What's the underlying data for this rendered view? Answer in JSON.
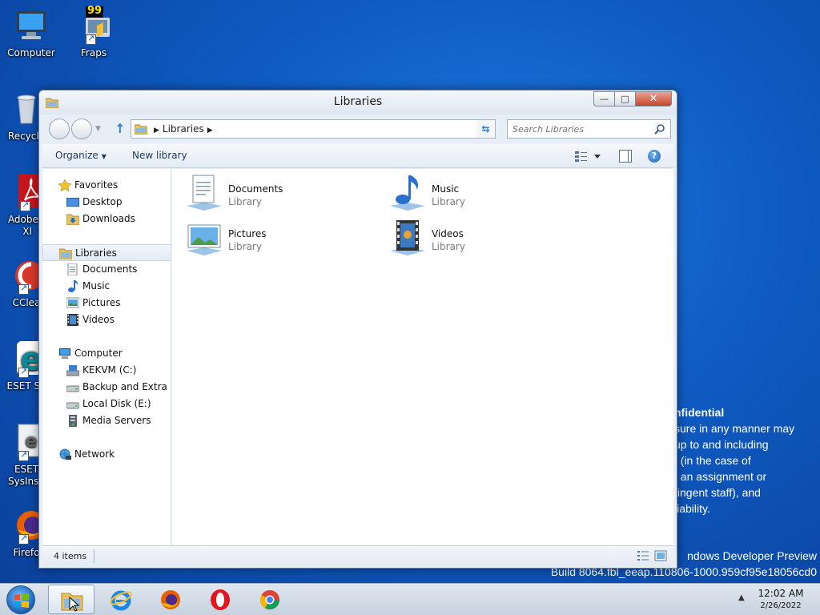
{
  "desktop": {
    "icons": [
      {
        "label": "Computer"
      },
      {
        "label": "Fraps",
        "badge": "99"
      },
      {
        "label": "Recycle"
      },
      {
        "label": "Adobe R",
        "label2": "XI"
      },
      {
        "label": "CClea"
      },
      {
        "label": "ESET Se"
      },
      {
        "label": "ESET",
        "label2": "SysInsp"
      },
      {
        "label": "Firefo"
      }
    ],
    "watermark": {
      "title": "nfidential",
      "lines": [
        "sure in any manner may",
        "up to and including",
        "t (in the case of",
        "f an assignment or",
        "tingent staff), and",
        "liability."
      ]
    },
    "build": {
      "line1": "ndows Developer Preview",
      "line2": "Build 8064.fbl_eeap.110806-1000.959cf95e18056cd0"
    }
  },
  "window": {
    "title": "Libraries",
    "controls": {
      "minimize": "—",
      "maximize": "□",
      "close": "✕"
    },
    "address": {
      "crumb": "Libraries"
    },
    "search": {
      "placeholder": "Search Libraries"
    },
    "commands": {
      "organize": "Organize",
      "new_library": "New library",
      "help": "?"
    },
    "nav": {
      "favorites": "Favorites",
      "desktop": "Desktop",
      "downloads": "Downloads",
      "libraries": "Libraries",
      "documents": "Documents",
      "music": "Music",
      "pictures": "Pictures",
      "videos": "Videos",
      "computer": "Computer",
      "drive_c": "KEKVM (C:)",
      "drive_backup": "Backup and Extra Sto",
      "drive_e": "Local Disk (E:)",
      "media_servers": "Media Servers",
      "network": "Network"
    },
    "libraries": [
      {
        "name": "Documents",
        "type": "Library"
      },
      {
        "name": "Music",
        "type": "Library"
      },
      {
        "name": "Pictures",
        "type": "Library"
      },
      {
        "name": "Videos",
        "type": "Library"
      }
    ],
    "status": {
      "count": "4 items"
    }
  },
  "taskbar": {
    "time": "12:02 AM",
    "date": "2/26/2022"
  },
  "colors": {
    "desktop_bg": "#0f5cc4",
    "close_red": "#c8432a",
    "accent_blue": "#2a7fd6"
  }
}
